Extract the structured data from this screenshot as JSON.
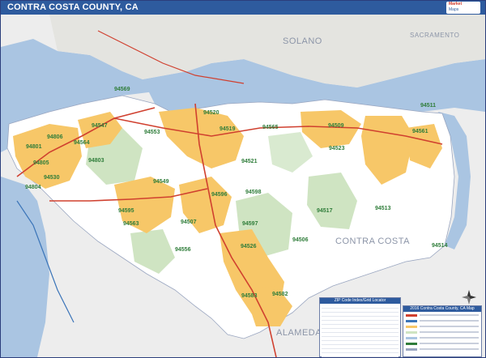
{
  "map": {
    "title": "CONTRA COSTA COUNTY, CA",
    "neighbor_labels": [
      "SOLANO",
      "SACRAMENTO",
      "CONTRA COSTA",
      "ALAMEDA"
    ],
    "zip_codes": [
      "94801",
      "94806",
      "94547",
      "94564",
      "94805",
      "94803",
      "94530",
      "94804",
      "94553",
      "94569",
      "94519",
      "94520",
      "94565",
      "94509",
      "94561",
      "94511",
      "94521",
      "94523",
      "94549",
      "94595",
      "94598",
      "94517",
      "94513",
      "94563",
      "94596",
      "94597",
      "94507",
      "94506",
      "94514",
      "94556",
      "94526",
      "94583",
      "94582"
    ],
    "index_panel_title": "ZIP Code Index/Grid Locator",
    "legend_panel_title": "2016 Contra Costa County, CA Map"
  },
  "colors": {
    "water": "#aac5e2",
    "urban": "#f7c768",
    "park": "#cfe4c2",
    "land": "#ffffff",
    "outside": "#ededed",
    "highway": "#d0402f",
    "title_bar": "#2e5b9e",
    "zip_label": "#2f7d3a"
  },
  "logo": {
    "line1": "Market",
    "line2": "Maps",
    "line3": "Wall Map"
  }
}
